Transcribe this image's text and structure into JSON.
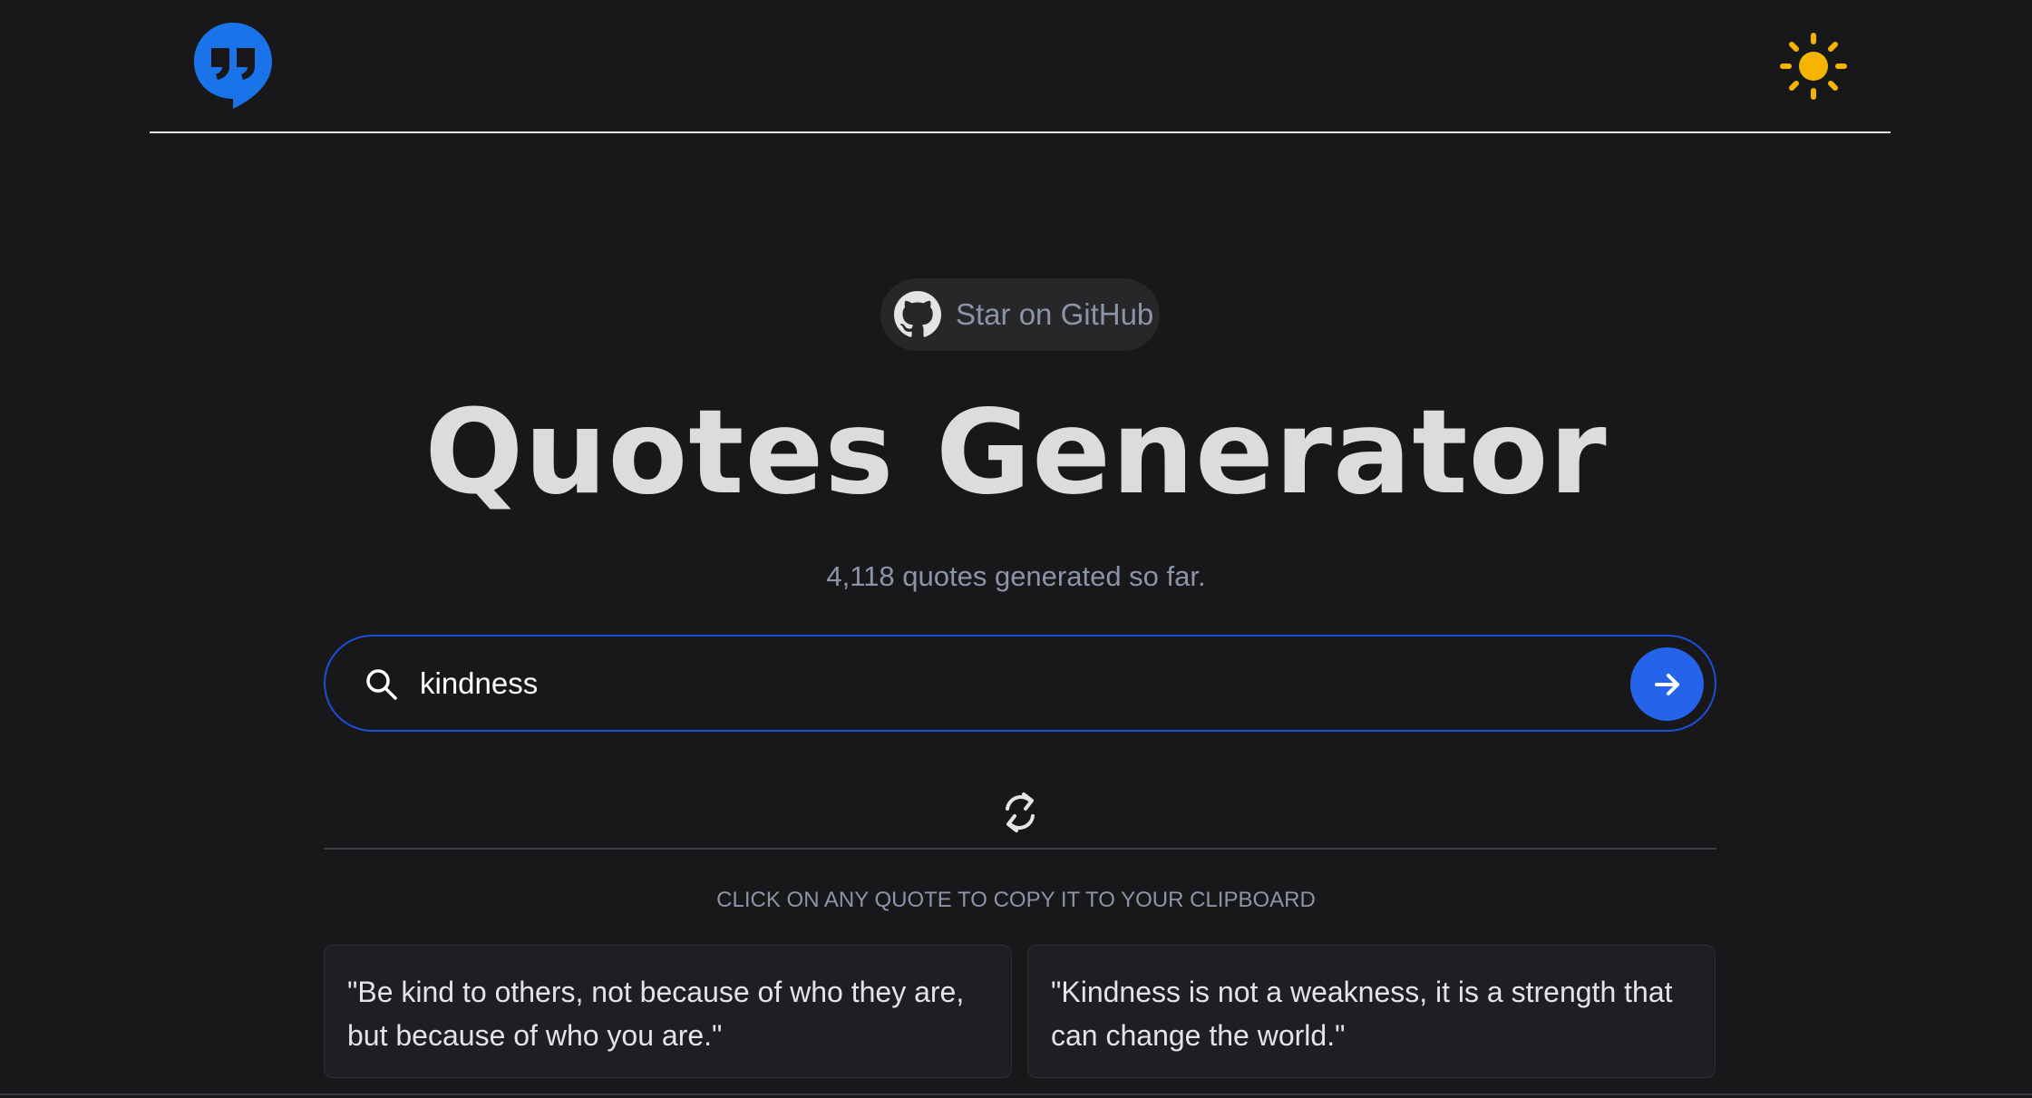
{
  "header": {
    "logo_icon": "quote-bubble-icon",
    "theme_toggle_icon": "sun-icon"
  },
  "github": {
    "icon": "github-icon",
    "label": "Star on GitHub"
  },
  "hero": {
    "title": "Quotes Generator",
    "counter": "4,118 quotes generated so far."
  },
  "search": {
    "value": "kindness",
    "icon": "search-icon",
    "submit_icon": "arrow-right-icon"
  },
  "refresh_icon": "refresh-icon",
  "hint": "CLICK ON ANY QUOTE TO COPY IT TO YOUR CLIPBOARD",
  "quotes": [
    "\"Be kind to others, not because of who they are, but because of who you are.\"",
    "\"Kindness is not a weakness, it is a strength that can change the world.\""
  ],
  "colors": {
    "background": "#18181b",
    "accent": "#2563eb",
    "sun": "#f4b400",
    "muted_text": "#8b95a7"
  }
}
